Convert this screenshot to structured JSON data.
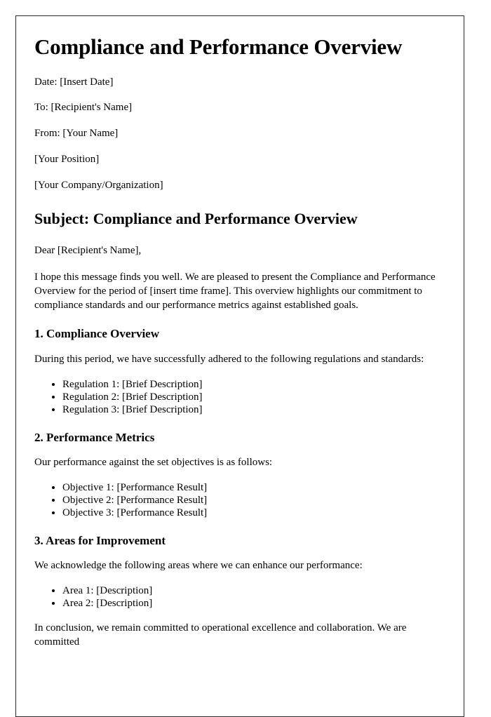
{
  "document": {
    "title": "Compliance and Performance Overview",
    "meta": [
      "Date: [Insert Date]",
      "To: [Recipient's Name]",
      "From: [Your Name]",
      "[Your Position]",
      "[Your Company/Organization]"
    ],
    "subject_heading": "Subject: Compliance and Performance Overview",
    "salutation": "Dear [Recipient's Name],",
    "intro_paragraph": "I hope this message finds you well. We are pleased to present the Compliance and Performance Overview for the period of [insert time frame]. This overview highlights our commitment to compliance standards and our performance metrics against established goals.",
    "sections": [
      {
        "heading": "1. Compliance Overview",
        "intro": "During this period, we have successfully adhered to the following regulations and standards:",
        "bullets": [
          "Regulation 1: [Brief Description]",
          "Regulation 2: [Brief Description]",
          "Regulation 3: [Brief Description]"
        ]
      },
      {
        "heading": "2. Performance Metrics",
        "intro": "Our performance against the set objectives is as follows:",
        "bullets": [
          "Objective 1: [Performance Result]",
          "Objective 2: [Performance Result]",
          "Objective 3: [Performance Result]"
        ]
      },
      {
        "heading": "3. Areas for Improvement",
        "intro": "We acknowledge the following areas where we can enhance our performance:",
        "bullets": [
          "Area 1: [Description]",
          "Area 2: [Description]"
        ]
      }
    ],
    "closing_paragraph": "In conclusion, we remain committed to operational excellence and collaboration. We are committed"
  }
}
